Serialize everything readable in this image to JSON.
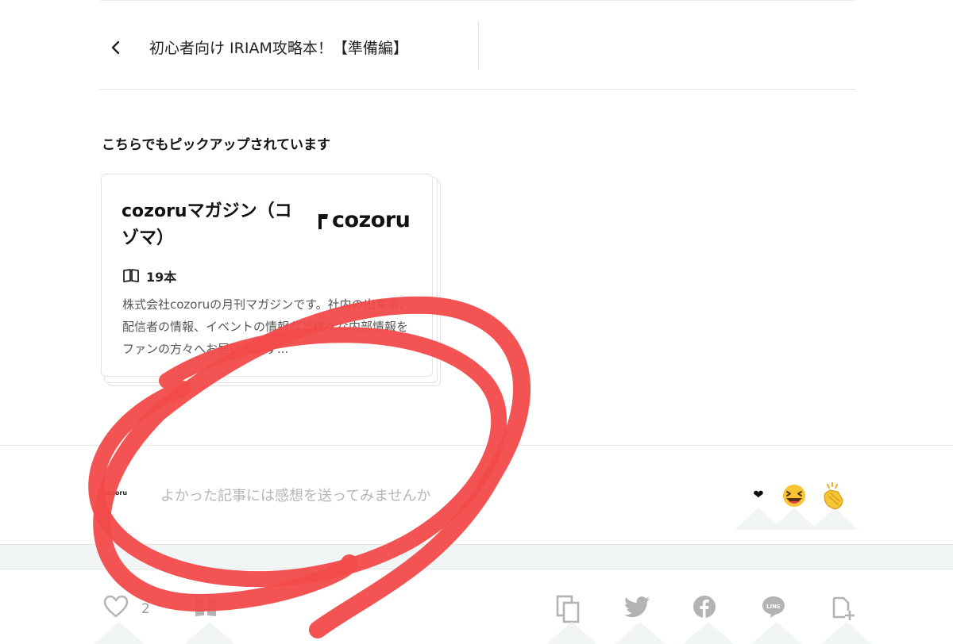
{
  "nav": {
    "prev_article_title": "初心者向け IRIAM攻略本！【準備編】"
  },
  "pickup": {
    "heading": "こちらでもピックアップされています",
    "magazine": {
      "title": "cozoruマガジン（コゾマ）",
      "logo_text": "cozoru",
      "article_count": "19本",
      "description": "株式会社cozoruの月刊マガジンです。社内の出来事、配信者の情報、イベントの情報など様々な内部情報をファンの方々へお届けします..."
    }
  },
  "feedback": {
    "creator_logo_text": "cozoru",
    "placeholder": "よかった記事には感想を送ってみませんか",
    "reactions": [
      "heart-icon",
      "laughing-face-icon",
      "clapping-hands-icon"
    ]
  },
  "actions": {
    "like_count": "2",
    "icons": [
      "heart-outline-icon",
      "magazine-icon",
      "copy-link-icon",
      "twitter-icon",
      "facebook-icon",
      "line-icon",
      "add-to-magazine-icon"
    ]
  },
  "colors": {
    "annotation_red": "#f24a4a",
    "icon_gray": "#b3b3b3"
  }
}
